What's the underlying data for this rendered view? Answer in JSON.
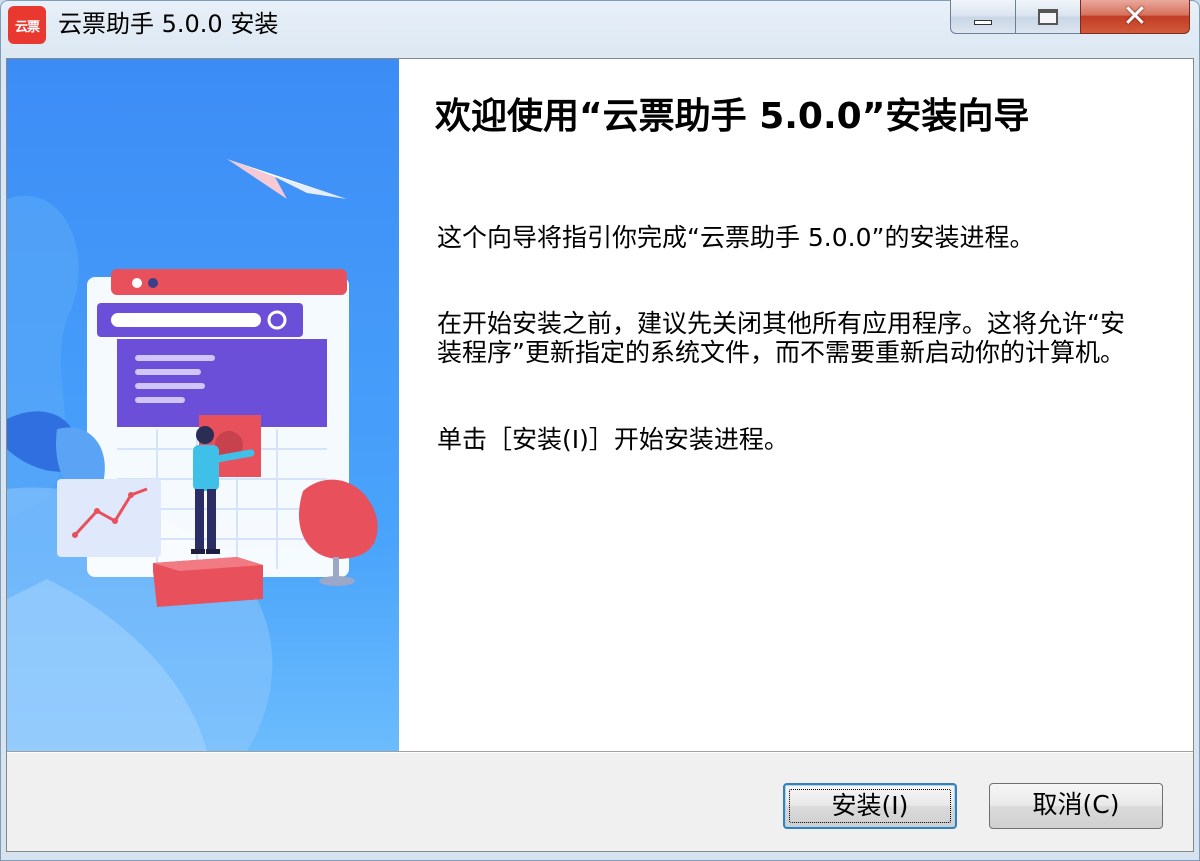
{
  "window": {
    "title": "云票助手 5.0.0 安装",
    "app_icon_text": "云票",
    "controls": {
      "minimize_icon": "minimize-icon",
      "maximize_icon": "maximize-icon",
      "close_icon": "close-icon",
      "close_glyph": "✕"
    }
  },
  "wizard": {
    "heading": "欢迎使用“云票助手 5.0.0”安装向导",
    "paragraph1": "这个向导将指引你完成“云票助手 5.0.0”的安装进程。",
    "paragraph2": "在开始安装之前，建议先关闭其他所有应用程序。这将允许“安装程序”更新指定的系统文件，而不需要重新启动你的计算机。",
    "paragraph3": "单击［安装(I)］开始安装进程。"
  },
  "buttons": {
    "install": "安装(I)",
    "cancel": "取消(C)"
  },
  "colors": {
    "art_blue": "#3c8cf6",
    "accent_red": "#e8505b",
    "accent_purple": "#6b4fd8",
    "close_red": "#c23c24"
  }
}
